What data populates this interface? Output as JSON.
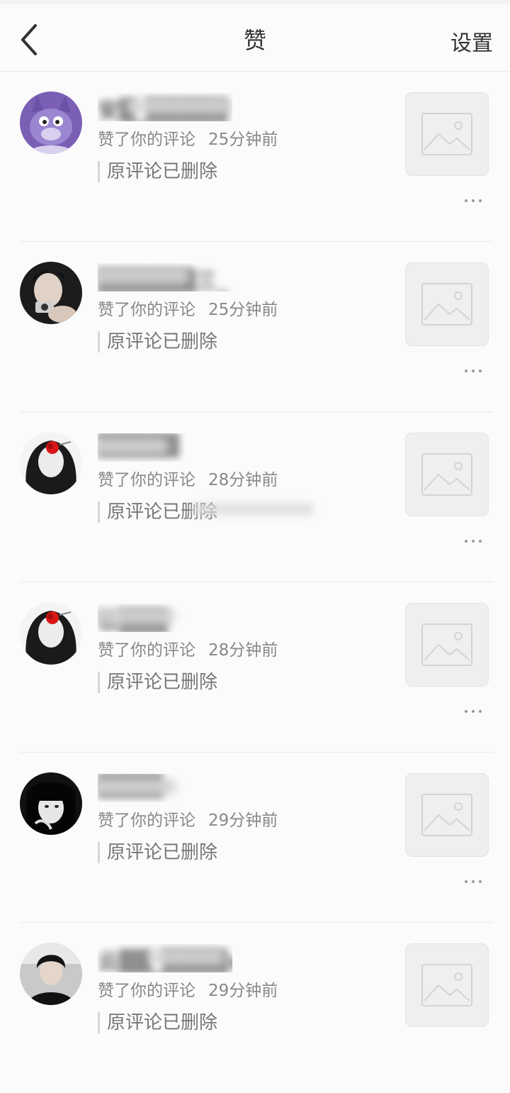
{
  "header": {
    "title": "赞",
    "settings_label": "设置"
  },
  "items": [
    {
      "name": "安▒_▒▒▒▒▒",
      "action": "赞了你的评论",
      "time": "25分钟前",
      "quote": "原评论已删除",
      "avatar": "cartoon-cat-avatar"
    },
    {
      "name": "▒▒▒▒▒▒三_",
      "action": "赞了你的评论",
      "time": "25分钟前",
      "quote": "原评论已删除",
      "avatar": "person-photo-avatar"
    },
    {
      "name": "▒▒▒▒▒",
      "action": "赞了你的评论",
      "time": "28分钟前",
      "quote": "原评论已删除",
      "avatar": "girl-red-rose-avatar"
    },
    {
      "name": "板▒▒▒",
      "action": "赞了你的评论",
      "time": "28分钟前",
      "quote": "原评论已删除",
      "avatar": "girl-red-rose-avatar"
    },
    {
      "name": "▒▒▒▒-",
      "action": "赞了你的评论",
      "time": "29分钟前",
      "quote": "原评论已删除",
      "avatar": "girl-dark-hair-avatar"
    },
    {
      "name": "云▒▒_▒▒▒▒xx",
      "action": "赞了你的评论",
      "time": "29分钟前",
      "quote": "原评论已删除",
      "avatar": "boy-photo-avatar"
    }
  ],
  "colors": {
    "background": "#fbfbfb",
    "divider": "#e8e8e8",
    "meta_text": "#888888",
    "placeholder": "#efefef"
  }
}
